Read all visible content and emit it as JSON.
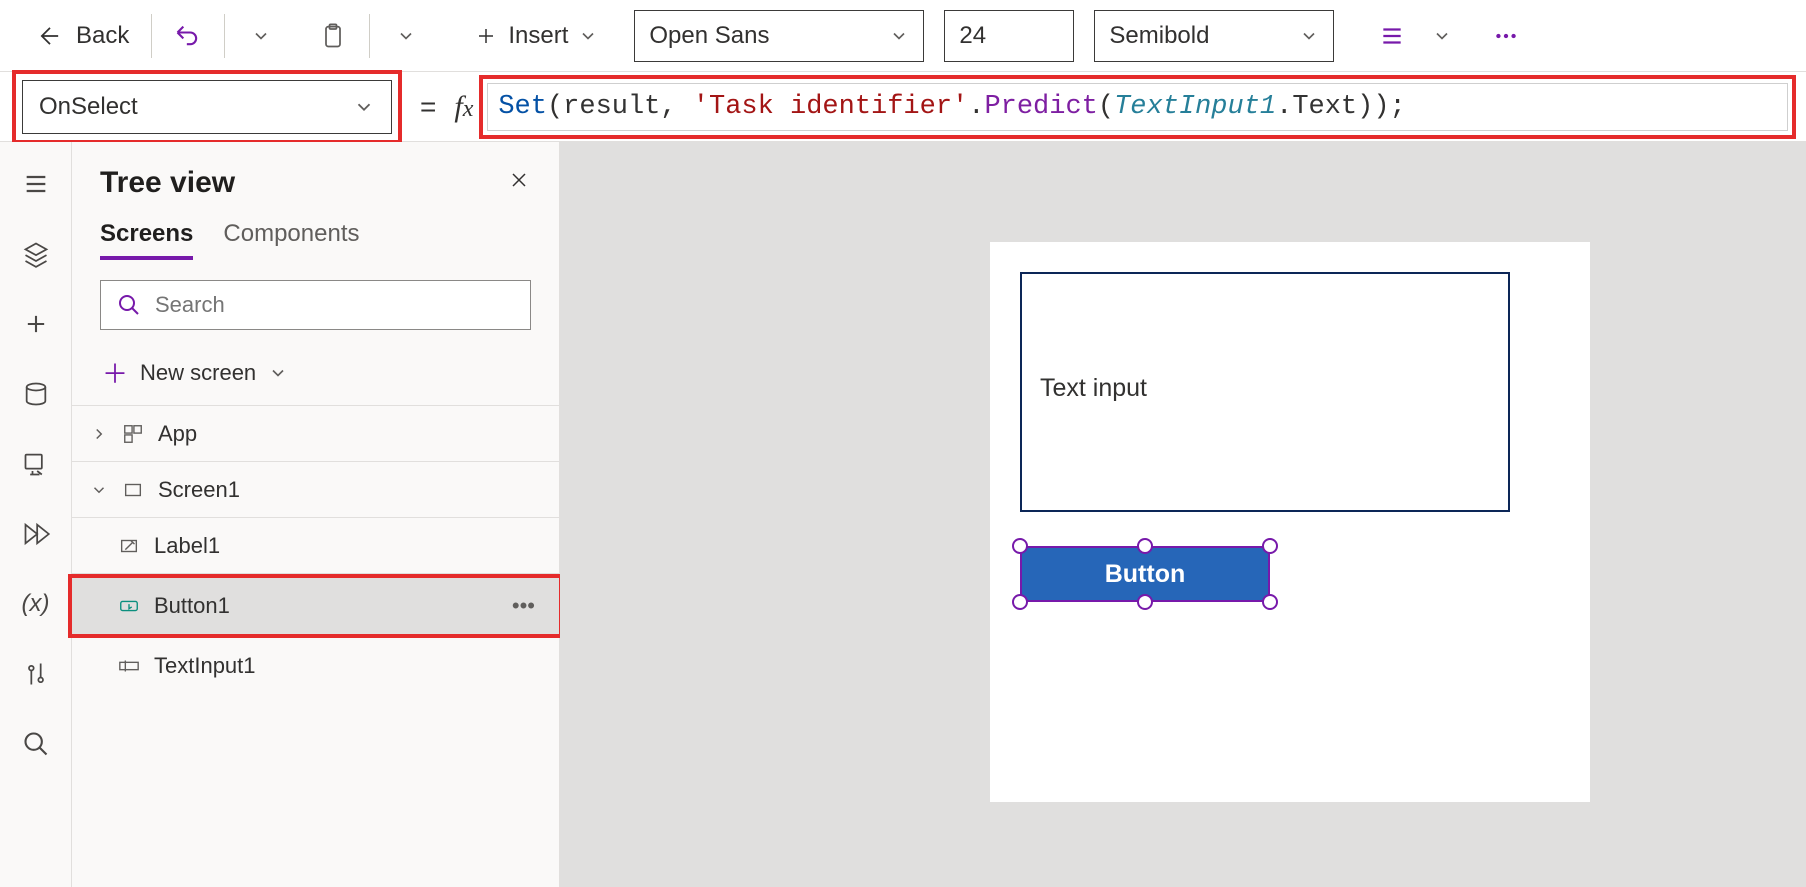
{
  "toolbar": {
    "back": "Back",
    "insert": "Insert",
    "font": "Open Sans",
    "font_size": "24",
    "font_weight": "Semibold"
  },
  "formula": {
    "property": "OnSelect",
    "tokens": {
      "set": "Set",
      "open1": "(",
      "result": "result",
      "comma1": ", ",
      "str": "'Task identifier'",
      "dot1": ".",
      "predict": "Predict",
      "open2": "(",
      "textinput": "TextInput1",
      "dot2": ".",
      "text": "Text",
      "close": "));"
    }
  },
  "tree": {
    "title": "Tree view",
    "tabs": {
      "screens": "Screens",
      "components": "Components"
    },
    "search_placeholder": "Search",
    "new_screen": "New screen",
    "items": {
      "app": "App",
      "screen1": "Screen1",
      "label1": "Label1",
      "button1": "Button1",
      "textinput1": "TextInput1"
    }
  },
  "canvas": {
    "text_input_value": "Text input",
    "button_label": "Button"
  }
}
